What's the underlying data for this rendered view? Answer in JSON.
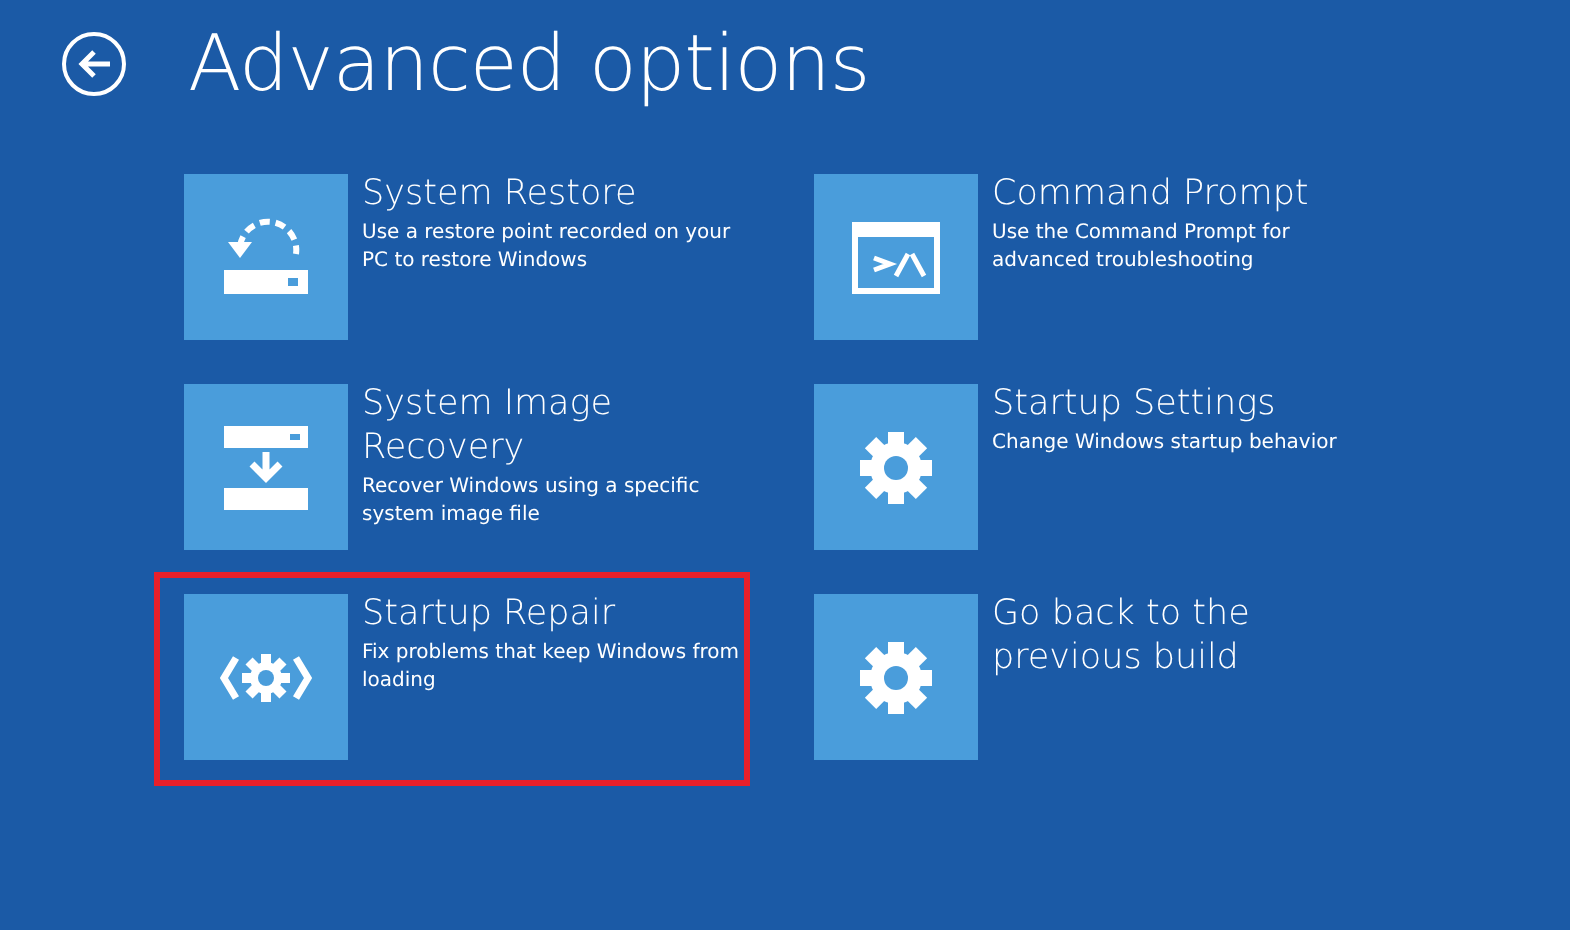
{
  "header": {
    "title": "Advanced options"
  },
  "options": [
    {
      "kind": "restore",
      "title": "System Restore",
      "description": "Use a restore point recorded on your PC to restore Windows",
      "highlighted": false
    },
    {
      "kind": "command",
      "title": "Command Prompt",
      "description": "Use the Command Prompt for advanced troubleshooting",
      "highlighted": false
    },
    {
      "kind": "image",
      "title": "System Image Recovery",
      "description": "Recover Windows using a specific system image file",
      "highlighted": false
    },
    {
      "kind": "gear",
      "title": "Startup Settings",
      "description": "Change Windows startup behavior",
      "highlighted": false
    },
    {
      "kind": "repair",
      "title": "Startup Repair",
      "description": "Fix problems that keep Windows from loading",
      "highlighted": true
    },
    {
      "kind": "gear",
      "title": "Go back to the previous build",
      "highlighted": false
    }
  ]
}
